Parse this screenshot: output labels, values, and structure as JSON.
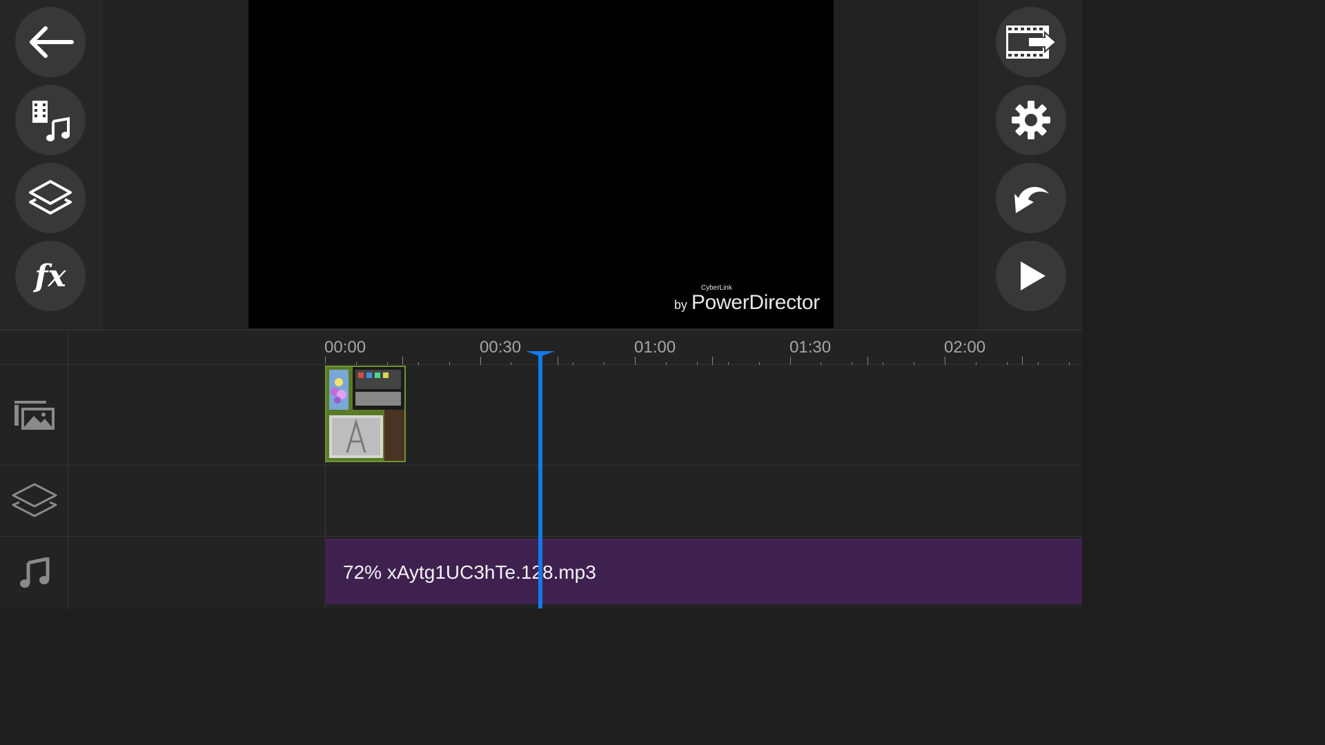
{
  "app": {
    "name": "PowerDirector"
  },
  "toolbar_left": [
    {
      "name": "back",
      "icon": "arrow-left-icon"
    },
    {
      "name": "media",
      "icon": "film-music-icon"
    },
    {
      "name": "layers",
      "icon": "layers-icon"
    },
    {
      "name": "effects",
      "icon": "fx-icon",
      "label": "fx"
    }
  ],
  "toolbar_right": [
    {
      "name": "produce",
      "icon": "film-export-icon"
    },
    {
      "name": "settings",
      "icon": "gear-icon"
    },
    {
      "name": "undo",
      "icon": "undo-icon"
    },
    {
      "name": "play",
      "icon": "play-icon"
    }
  ],
  "watermark": {
    "by": "by",
    "cyberlink": "CyberLink",
    "brand": "PowerDirector"
  },
  "ruler": {
    "labels": [
      "00:00",
      "00:30",
      "01:00",
      "01:30",
      "02:00"
    ]
  },
  "tracks": [
    {
      "name": "video",
      "icon": "video-image-track-icon"
    },
    {
      "name": "overlay",
      "icon": "layers-track-icon"
    },
    {
      "name": "audio",
      "icon": "music-note-track-icon"
    }
  ],
  "audio_clip": {
    "label": "72% xAytg1UC3hTe.128.mp3"
  },
  "colors": {
    "accent": "#1479e8",
    "audio_clip": "#3f2150",
    "video_clip_border": "#6f9633"
  }
}
